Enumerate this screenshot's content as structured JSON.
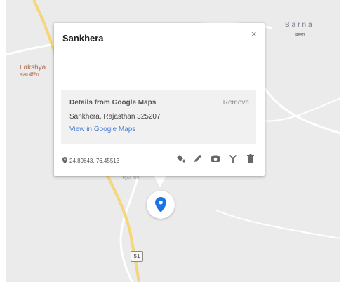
{
  "map": {
    "labels": {
      "lakshya": "Lakshya",
      "lakshya_hindi": "लक्ष्य बेटिंग",
      "barna": "Barna",
      "barna_hindi": "बरना",
      "road_hindi": "स्कूल मार्ग"
    },
    "highway_shield": "51",
    "colors": {
      "background": "#ebebeb",
      "major_road": "#f5d67a",
      "minor_road": "#ffffff",
      "marker": "#1a73e8"
    }
  },
  "popup": {
    "title": "Sankhera",
    "close_glyph": "×",
    "details": {
      "heading": "Details from Google Maps",
      "remove": "Remove",
      "address": "Sankhera, Rajasthan 325207",
      "link": "View in Google Maps"
    },
    "coordinates": "24.89643, 76.45513",
    "tools": [
      "paint-bucket-icon",
      "pencil-icon",
      "camera-icon",
      "directions-icon",
      "trash-icon"
    ]
  }
}
